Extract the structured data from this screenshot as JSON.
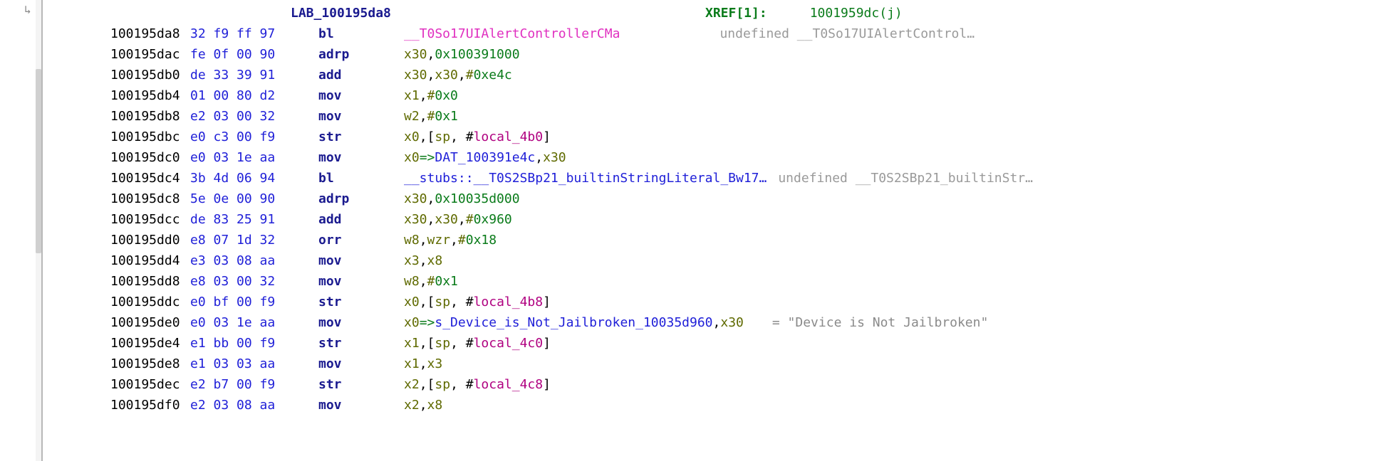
{
  "label": {
    "name": "LAB_100195da8",
    "xref_key": "XREF[1]:",
    "xref_val": "1001959dc(j)"
  },
  "rows": [
    {
      "addr": "100195da8",
      "bytes": [
        "32",
        "f9",
        "ff",
        "97"
      ],
      "mnemonic": "bl",
      "op": [
        {
          "t": "call",
          "v": "__T0So17UIAlertControllerCMa"
        }
      ],
      "eol": "undefined __T0So17UIAlertControl…"
    },
    {
      "addr": "100195dac",
      "bytes": [
        "fe",
        "0f",
        "00",
        "90"
      ],
      "mnemonic": "adrp",
      "op": [
        {
          "t": "reg",
          "v": "x30"
        },
        {
          "t": "p",
          "v": ","
        },
        {
          "t": "num",
          "v": "0x100391000"
        }
      ]
    },
    {
      "addr": "100195db0",
      "bytes": [
        "de",
        "33",
        "39",
        "91"
      ],
      "mnemonic": "add",
      "op": [
        {
          "t": "reg",
          "v": "x30"
        },
        {
          "t": "p",
          "v": ","
        },
        {
          "t": "reg",
          "v": "x30"
        },
        {
          "t": "p",
          "v": ","
        },
        {
          "t": "reg",
          "v": "#"
        },
        {
          "t": "num",
          "v": "0xe4c"
        }
      ]
    },
    {
      "addr": "100195db4",
      "bytes": [
        "01",
        "00",
        "80",
        "d2"
      ],
      "mnemonic": "mov",
      "op": [
        {
          "t": "reg",
          "v": "x1"
        },
        {
          "t": "p",
          "v": ","
        },
        {
          "t": "reg",
          "v": "#"
        },
        {
          "t": "num",
          "v": "0x0"
        }
      ]
    },
    {
      "addr": "100195db8",
      "bytes": [
        "e2",
        "03",
        "00",
        "32"
      ],
      "mnemonic": "mov",
      "op": [
        {
          "t": "reg",
          "v": "w2"
        },
        {
          "t": "p",
          "v": ","
        },
        {
          "t": "reg",
          "v": "#"
        },
        {
          "t": "num",
          "v": "0x1"
        }
      ]
    },
    {
      "addr": "100195dbc",
      "bytes": [
        "e0",
        "c3",
        "00",
        "f9"
      ],
      "mnemonic": "str",
      "op": [
        {
          "t": "reg",
          "v": "x0"
        },
        {
          "t": "p",
          "v": ",["
        },
        {
          "t": "reg",
          "v": "sp"
        },
        {
          "t": "p",
          "v": ", #"
        },
        {
          "t": "loc",
          "v": "local_4b0"
        },
        {
          "t": "p",
          "v": "]"
        }
      ]
    },
    {
      "addr": "100195dc0",
      "bytes": [
        "e0",
        "03",
        "1e",
        "aa"
      ],
      "mnemonic": "mov",
      "op": [
        {
          "t": "reg",
          "v": "x0"
        },
        {
          "t": "num",
          "v": "=>"
        },
        {
          "t": "sym",
          "v": "DAT_100391e4c"
        },
        {
          "t": "p",
          "v": ","
        },
        {
          "t": "reg",
          "v": "x30"
        }
      ]
    },
    {
      "addr": "100195dc4",
      "bytes": [
        "3b",
        "4d",
        "06",
        "94"
      ],
      "mnemonic": "bl",
      "op": [
        {
          "t": "sym",
          "v": "__stubs::__T0S2SBp21_builtinStringLiteral_Bw17…"
        }
      ],
      "eol_tight": "undefined __T0S2SBp21_builtinStr…"
    },
    {
      "addr": "100195dc8",
      "bytes": [
        "5e",
        "0e",
        "00",
        "90"
      ],
      "mnemonic": "adrp",
      "op": [
        {
          "t": "reg",
          "v": "x30"
        },
        {
          "t": "p",
          "v": ","
        },
        {
          "t": "num",
          "v": "0x10035d000"
        }
      ]
    },
    {
      "addr": "100195dcc",
      "bytes": [
        "de",
        "83",
        "25",
        "91"
      ],
      "mnemonic": "add",
      "op": [
        {
          "t": "reg",
          "v": "x30"
        },
        {
          "t": "p",
          "v": ","
        },
        {
          "t": "reg",
          "v": "x30"
        },
        {
          "t": "p",
          "v": ","
        },
        {
          "t": "reg",
          "v": "#"
        },
        {
          "t": "num",
          "v": "0x960"
        }
      ]
    },
    {
      "addr": "100195dd0",
      "bytes": [
        "e8",
        "07",
        "1d",
        "32"
      ],
      "mnemonic": "orr",
      "op": [
        {
          "t": "reg",
          "v": "w8"
        },
        {
          "t": "p",
          "v": ","
        },
        {
          "t": "reg",
          "v": "wzr"
        },
        {
          "t": "p",
          "v": ","
        },
        {
          "t": "reg",
          "v": "#"
        },
        {
          "t": "num",
          "v": "0x18"
        }
      ]
    },
    {
      "addr": "100195dd4",
      "bytes": [
        "e3",
        "03",
        "08",
        "aa"
      ],
      "mnemonic": "mov",
      "op": [
        {
          "t": "reg",
          "v": "x3"
        },
        {
          "t": "p",
          "v": ","
        },
        {
          "t": "reg",
          "v": "x8"
        }
      ]
    },
    {
      "addr": "100195dd8",
      "bytes": [
        "e8",
        "03",
        "00",
        "32"
      ],
      "mnemonic": "mov",
      "op": [
        {
          "t": "reg",
          "v": "w8"
        },
        {
          "t": "p",
          "v": ","
        },
        {
          "t": "reg",
          "v": "#"
        },
        {
          "t": "num",
          "v": "0x1"
        }
      ]
    },
    {
      "addr": "100195ddc",
      "bytes": [
        "e0",
        "bf",
        "00",
        "f9"
      ],
      "mnemonic": "str",
      "op": [
        {
          "t": "reg",
          "v": "x0"
        },
        {
          "t": "p",
          "v": ",["
        },
        {
          "t": "reg",
          "v": "sp"
        },
        {
          "t": "p",
          "v": ", #"
        },
        {
          "t": "loc",
          "v": "local_4b8"
        },
        {
          "t": "p",
          "v": "]"
        }
      ]
    },
    {
      "addr": "100195de0",
      "bytes": [
        "e0",
        "03",
        "1e",
        "aa"
      ],
      "mnemonic": "mov",
      "op": [
        {
          "t": "reg",
          "v": "x0"
        },
        {
          "t": "num",
          "v": "=>"
        },
        {
          "t": "sym",
          "v": "s_Device_is_Not_Jailbroken_10035d960"
        },
        {
          "t": "p",
          "v": ","
        },
        {
          "t": "reg",
          "v": "x30"
        }
      ],
      "eq": "= \"Device is Not Jailbroken\""
    },
    {
      "addr": "100195de4",
      "bytes": [
        "e1",
        "bb",
        "00",
        "f9"
      ],
      "mnemonic": "str",
      "op": [
        {
          "t": "reg",
          "v": "x1"
        },
        {
          "t": "p",
          "v": ",["
        },
        {
          "t": "reg",
          "v": "sp"
        },
        {
          "t": "p",
          "v": ", #"
        },
        {
          "t": "loc",
          "v": "local_4c0"
        },
        {
          "t": "p",
          "v": "]"
        }
      ]
    },
    {
      "addr": "100195de8",
      "bytes": [
        "e1",
        "03",
        "03",
        "aa"
      ],
      "mnemonic": "mov",
      "op": [
        {
          "t": "reg",
          "v": "x1"
        },
        {
          "t": "p",
          "v": ","
        },
        {
          "t": "reg",
          "v": "x3"
        }
      ]
    },
    {
      "addr": "100195dec",
      "bytes": [
        "e2",
        "b7",
        "00",
        "f9"
      ],
      "mnemonic": "str",
      "op": [
        {
          "t": "reg",
          "v": "x2"
        },
        {
          "t": "p",
          "v": ",["
        },
        {
          "t": "reg",
          "v": "sp"
        },
        {
          "t": "p",
          "v": ", #"
        },
        {
          "t": "loc",
          "v": "local_4c8"
        },
        {
          "t": "p",
          "v": "]"
        }
      ]
    },
    {
      "addr": "100195df0",
      "bytes": [
        "e2",
        "03",
        "08",
        "aa"
      ],
      "mnemonic": "mov",
      "op": [
        {
          "t": "reg",
          "v": "x2"
        },
        {
          "t": "p",
          "v": ","
        },
        {
          "t": "reg",
          "v": "x8"
        }
      ]
    }
  ]
}
